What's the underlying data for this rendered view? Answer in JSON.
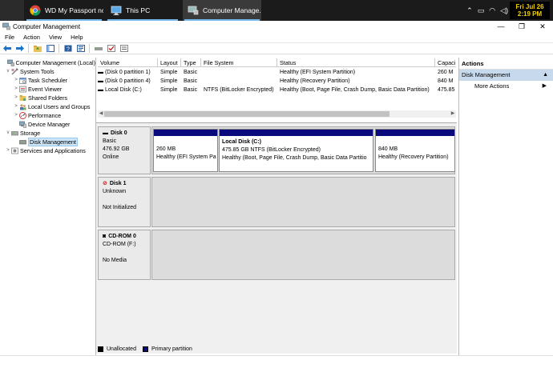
{
  "taskbar": {
    "tasks": [
      {
        "label": "WD My Passport no...",
        "icon": "chrome-icon",
        "active": false
      },
      {
        "label": "This PC",
        "icon": "this-pc-icon",
        "active": false
      },
      {
        "label": "Computer Manage...",
        "icon": "computer-management-icon",
        "active": true
      }
    ],
    "clock": {
      "day": "Fri Jul 26",
      "time": "2:19 PM"
    }
  },
  "window": {
    "title": "Computer Management"
  },
  "menu": [
    "File",
    "Action",
    "View",
    "Help"
  ],
  "tree": [
    {
      "label": "Computer Management (Local)",
      "level": 0,
      "expand": "",
      "icon": "computer-management-icon",
      "selected": false
    },
    {
      "label": "System Tools",
      "level": 1,
      "expand": "v",
      "icon": "system-tools-icon",
      "selected": false
    },
    {
      "label": "Task Scheduler",
      "level": 2,
      "expand": ">",
      "icon": "task-scheduler-icon",
      "selected": false
    },
    {
      "label": "Event Viewer",
      "level": 2,
      "expand": ">",
      "icon": "event-viewer-icon",
      "selected": false
    },
    {
      "label": "Shared Folders",
      "level": 2,
      "expand": ">",
      "icon": "shared-folders-icon",
      "selected": false
    },
    {
      "label": "Local Users and Groups",
      "level": 2,
      "expand": ">",
      "icon": "users-groups-icon",
      "selected": false
    },
    {
      "label": "Performance",
      "level": 2,
      "expand": ">",
      "icon": "performance-icon",
      "selected": false
    },
    {
      "label": "Device Manager",
      "level": 2,
      "expand": "",
      "icon": "device-manager-icon",
      "selected": false
    },
    {
      "label": "Storage",
      "level": 1,
      "expand": "v",
      "icon": "storage-icon",
      "selected": false
    },
    {
      "label": "Disk Management",
      "level": 2,
      "expand": "",
      "icon": "disk-management-icon",
      "selected": true
    },
    {
      "label": "Services and Applications",
      "level": 1,
      "expand": ">",
      "icon": "services-icon",
      "selected": false
    }
  ],
  "volumes": {
    "columns": [
      "Volume",
      "Layout",
      "Type",
      "File System",
      "Status",
      "Capaci"
    ],
    "rows": [
      {
        "volume": "(Disk 0 partition 1)",
        "layout": "Simple",
        "type": "Basic",
        "fs": "",
        "status": "Healthy (EFI System Partition)",
        "capacity": "260 M"
      },
      {
        "volume": "(Disk 0 partition 4)",
        "layout": "Simple",
        "type": "Basic",
        "fs": "",
        "status": "Healthy (Recovery Partition)",
        "capacity": "840 M"
      },
      {
        "volume": "Local Disk (C:)",
        "layout": "Simple",
        "type": "Basic",
        "fs": "NTFS (BitLocker Encrypted)",
        "status": "Healthy (Boot, Page File, Crash Dump, Basic Data Partition)",
        "capacity": "475.85"
      }
    ]
  },
  "disks": [
    {
      "name": "Disk 0",
      "lines": [
        "Basic",
        "476.92 GB",
        "Online"
      ],
      "partitions": [
        {
          "title": "",
          "lines": [
            "260 MB",
            "Healthy (EFI System Pa"
          ]
        },
        {
          "title": "Local Disk  (C:)",
          "lines": [
            "475.85 GB NTFS (BitLocker Encrypted)",
            "Healthy (Boot, Page File, Crash Dump, Basic Data Partitio"
          ]
        },
        {
          "title": "",
          "lines": [
            "840 MB",
            "Healthy (Recovery Partition)"
          ]
        }
      ]
    },
    {
      "name": "Disk 1",
      "lines": [
        "Unknown",
        "",
        "Not Initialized"
      ],
      "partitions": []
    },
    {
      "name": "CD-ROM 0",
      "lines": [
        "CD-ROM (F:)",
        "",
        "No Media"
      ],
      "partitions": []
    }
  ],
  "legend": [
    {
      "label": "Unallocated",
      "color": "#000000"
    },
    {
      "label": "Primary partition",
      "color": "#0a0a7c"
    }
  ],
  "actions": {
    "title": "Actions",
    "section": "Disk Management",
    "items": [
      "More Actions"
    ]
  }
}
